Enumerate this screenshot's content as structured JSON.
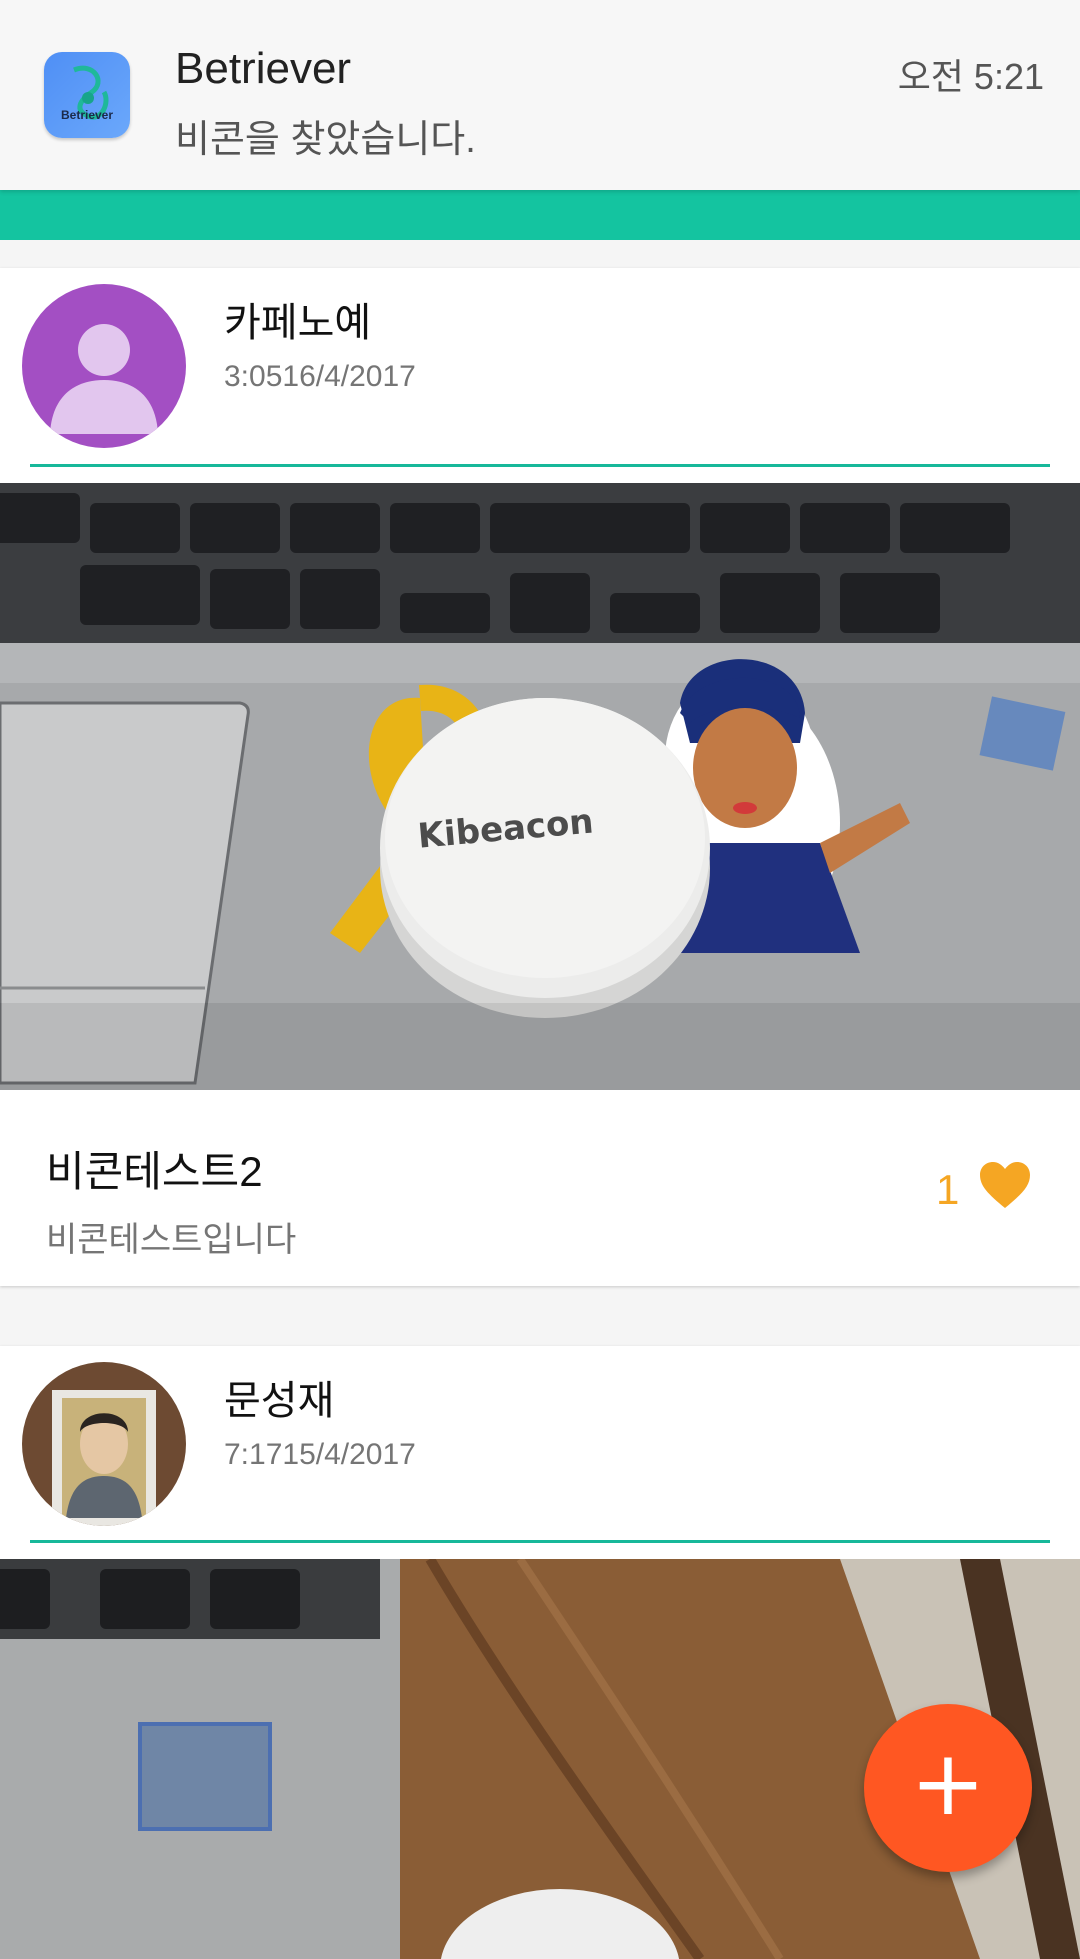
{
  "notification": {
    "app_icon_label": "Betriever",
    "title": "Betriever",
    "message": "비콘을 찾았습니다.",
    "time": "오전 5:21"
  },
  "colors": {
    "accent": "#14c4a0",
    "fab": "#ff5722",
    "like": "#f5a623",
    "avatar_default": "#a34fc3"
  },
  "posts": [
    {
      "author": "카페노예",
      "date": "3:0516/4/2017",
      "avatar_icon": "default-person-icon",
      "photo_text": "Kibeacon",
      "title": "비콘테스트2",
      "body": "비콘테스트입니다",
      "likes": "1",
      "like_icon": "heart-icon"
    },
    {
      "author": "문성재",
      "date": "7:1715/4/2017",
      "avatar_icon": "profile-photo"
    }
  ],
  "fab": {
    "label": "+"
  }
}
